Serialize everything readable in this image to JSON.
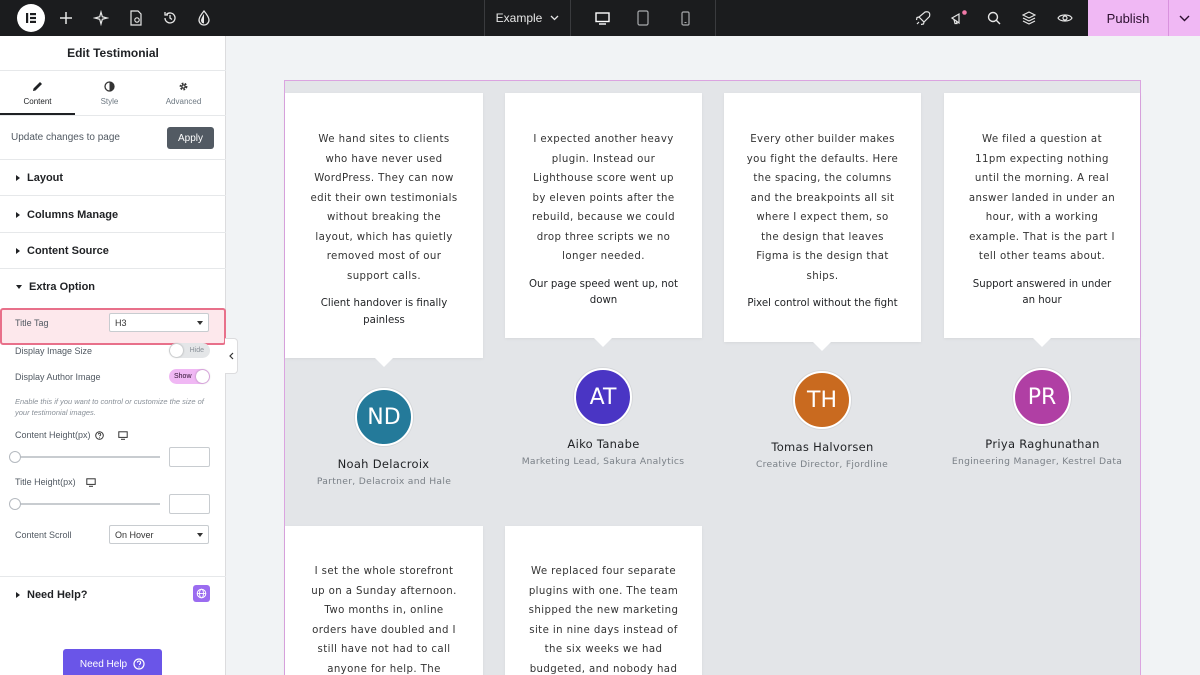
{
  "topbar": {
    "page_name": "Example",
    "publish_label": "Publish"
  },
  "panel": {
    "title": "Edit Testimonial",
    "tabs": [
      {
        "label": "Content",
        "icon": "pencil-icon"
      },
      {
        "label": "Style",
        "icon": "half-circle-icon"
      },
      {
        "label": "Advanced",
        "icon": "gear-icon"
      }
    ],
    "update_label": "Update changes to page",
    "apply_label": "Apply",
    "sections": [
      "Layout",
      "Columns Manage",
      "Content Source",
      "Extra Option"
    ],
    "title_tag_label": "Title Tag",
    "title_tag_value": "H3",
    "display_image_size_label": "Display Image Size",
    "display_image_size_state": "Hide",
    "display_author_image_label": "Display Author Image",
    "display_author_image_state": "Show",
    "help_text": "Enable this if you want to control or customize the size of your testimonial images.",
    "content_height_label": "Content Height(px)",
    "title_height_label": "Title Height(px)",
    "content_scroll_label": "Content Scroll",
    "content_scroll_value": "On Hover",
    "need_help_section": "Need Help?",
    "need_help_button": "Need Help"
  },
  "colors": {
    "accent": "#f0b8f4",
    "highlight_border": "#e8708a",
    "need_help": "#6a55e8"
  },
  "testimonials": [
    {
      "quote": "We hand sites to clients who have never used WordPress. They can now edit their own testimonials without breaking the layout, which has quietly removed most of our support calls.",
      "title": "Client handover is finally painless",
      "initials": "ND",
      "name": "Noah Delacroix",
      "role": "Partner, Delacroix and Hale",
      "color": "#247a9a"
    },
    {
      "quote": "I expected another heavy plugin. Instead our Lighthouse score went up by eleven points after the rebuild, because we could drop three scripts we no longer needed.",
      "title": "Our page speed went up, not down",
      "initials": "AT",
      "name": "Aiko Tanabe",
      "role": "Marketing Lead, Sakura Analytics",
      "color": "#4a35c4"
    },
    {
      "quote": "Every other builder makes you fight the defaults. Here the spacing, the columns and the breakpoints all sit where I expect them, so the design that leaves Figma is the design that ships.",
      "title": "Pixel control without the fight",
      "initials": "TH",
      "name": "Tomas Halvorsen",
      "role": "Creative Director, Fjordline",
      "color": "#c96a1f"
    },
    {
      "quote": "We filed a question at 11pm expecting nothing until the morning. A real answer landed in under an hour, with a working example. That is the part I tell other teams about.",
      "title": "Support answered in under an hour",
      "initials": "PR",
      "name": "Priya Raghunathan",
      "role": "Engineering Manager, Kestrel Data",
      "color": "#b03fa4"
    },
    {
      "quote": "I set the whole storefront up on a Sunday afternoon. Two months in, online orders have doubled and I still have not had to call anyone for help. The",
      "title": ""
    },
    {
      "quote": "We replaced four separate plugins with one. The team shipped the new marketing site in nine days instead of the six weeks we had budgeted, and nobody had",
      "title": ""
    }
  ]
}
